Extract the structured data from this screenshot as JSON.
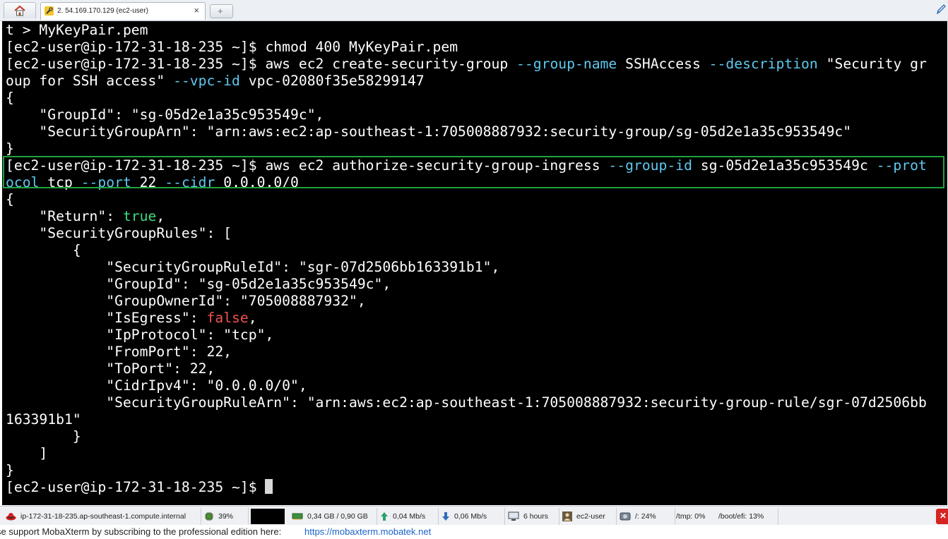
{
  "tabs": {
    "home_icon": "home-icon",
    "active_tab_title": "2. 54.169.170.129 (ec2-user)",
    "close_symbol": "×",
    "new_tab_symbol": "+"
  },
  "terminal": {
    "lines": [
      {
        "segments": [
          {
            "t": "t > MyKeyPair.pem",
            "c": ""
          }
        ]
      },
      {
        "segments": [
          {
            "t": "[ec2-user@ip-172-31-18-235 ~]$ chmod 400 MyKeyPair.pem",
            "c": ""
          }
        ]
      },
      {
        "segments": [
          {
            "t": "[ec2-user@ip-172-31-18-235 ~]$ aws ec2 create-security-group ",
            "c": ""
          },
          {
            "t": "--group-name",
            "c": "opt"
          },
          {
            "t": " SSHAccess ",
            "c": ""
          },
          {
            "t": "--description",
            "c": "opt"
          },
          {
            "t": " \"Security gr",
            "c": ""
          }
        ]
      },
      {
        "segments": [
          {
            "t": "oup for SSH access\" ",
            "c": ""
          },
          {
            "t": "--vpc-id",
            "c": "opt"
          },
          {
            "t": " vpc-02080f35e58299147",
            "c": ""
          }
        ]
      },
      {
        "segments": [
          {
            "t": "{",
            "c": ""
          }
        ]
      },
      {
        "segments": [
          {
            "t": "    \"GroupId\": \"sg-05d2e1a35c953549c\",",
            "c": ""
          }
        ]
      },
      {
        "segments": [
          {
            "t": "    \"SecurityGroupArn\": \"arn:aws:ec2:ap-southeast-1:705008887932:security-group/sg-05d2e1a35c953549c\"",
            "c": ""
          }
        ]
      },
      {
        "segments": [
          {
            "t": "}",
            "c": ""
          }
        ]
      },
      {
        "segments": [
          {
            "t": "[ec2-user@ip-172-31-18-235 ~]$ aws ec2 authorize-security-group-ingress ",
            "c": ""
          },
          {
            "t": "--group-id",
            "c": "opt"
          },
          {
            "t": " sg-05d2e1a35c953549c ",
            "c": ""
          },
          {
            "t": "--prot",
            "c": "opt"
          }
        ]
      },
      {
        "segments": [
          {
            "t": "ocol",
            "c": "opt"
          },
          {
            "t": " tcp ",
            "c": ""
          },
          {
            "t": "--port",
            "c": "opt"
          },
          {
            "t": " 22 ",
            "c": ""
          },
          {
            "t": "--cidr",
            "c": "opt"
          },
          {
            "t": " 0.0.0.0/0",
            "c": ""
          }
        ]
      },
      {
        "segments": [
          {
            "t": "{",
            "c": ""
          }
        ]
      },
      {
        "segments": [
          {
            "t": "    \"Return\": ",
            "c": ""
          },
          {
            "t": "true",
            "c": "true"
          },
          {
            "t": ",",
            "c": ""
          }
        ]
      },
      {
        "segments": [
          {
            "t": "    \"SecurityGroupRules\": [",
            "c": ""
          }
        ]
      },
      {
        "segments": [
          {
            "t": "        {",
            "c": ""
          }
        ]
      },
      {
        "segments": [
          {
            "t": "            \"SecurityGroupRuleId\": \"sgr-07d2506bb163391b1\",",
            "c": ""
          }
        ]
      },
      {
        "segments": [
          {
            "t": "            \"GroupId\": \"sg-05d2e1a35c953549c\",",
            "c": ""
          }
        ]
      },
      {
        "segments": [
          {
            "t": "            \"GroupOwnerId\": \"705008887932\",",
            "c": ""
          }
        ]
      },
      {
        "segments": [
          {
            "t": "            \"IsEgress\": ",
            "c": ""
          },
          {
            "t": "false",
            "c": "false"
          },
          {
            "t": ",",
            "c": ""
          }
        ]
      },
      {
        "segments": [
          {
            "t": "            \"IpProtocol\": \"tcp\",",
            "c": ""
          }
        ]
      },
      {
        "segments": [
          {
            "t": "            \"FromPort\": 22,",
            "c": ""
          }
        ]
      },
      {
        "segments": [
          {
            "t": "            \"ToPort\": 22,",
            "c": ""
          }
        ]
      },
      {
        "segments": [
          {
            "t": "            \"CidrIpv4\": \"0.0.0.0/0\",",
            "c": ""
          }
        ]
      },
      {
        "segments": [
          {
            "t": "            \"SecurityGroupRuleArn\": \"arn:aws:ec2:ap-southeast-1:705008887932:security-group-rule/sgr-07d2506bb",
            "c": ""
          }
        ]
      },
      {
        "segments": [
          {
            "t": "163391b1\"",
            "c": ""
          }
        ]
      },
      {
        "segments": [
          {
            "t": "        }",
            "c": ""
          }
        ]
      },
      {
        "segments": [
          {
            "t": "    ]",
            "c": ""
          }
        ]
      },
      {
        "segments": [
          {
            "t": "}",
            "c": ""
          }
        ]
      },
      {
        "segments": [
          {
            "t": "[ec2-user@ip-172-31-18-235 ~]$ ",
            "c": ""
          }
        ],
        "cursor": true
      }
    ]
  },
  "statusbar": {
    "hostname": "ip-172-31-18-235.ap-southeast-1.compute.internal",
    "cpu": "39%",
    "memory": "0,34 GB / 0,90 GB",
    "upload": "0,04 Mb/s",
    "download": "0,06 Mb/s",
    "uptime": "6 hours",
    "user": "ec2-user",
    "disk_root": "/: 24%",
    "disk_tmp": "/tmp: 0%",
    "disk_boot": "/boot/efi: 13%"
  },
  "promo": {
    "text": "se support MobaXterm by subscribing to the professional edition here:",
    "link": "https://mobaxterm.mobatek.net"
  },
  "colors": {
    "terminal_bg": "#000000",
    "option_color": "#5fc8ef",
    "true_color": "#3ddc84",
    "false_color": "#f0524f",
    "highlight_box": "#1fa33b",
    "link_color": "#1a62c9"
  }
}
